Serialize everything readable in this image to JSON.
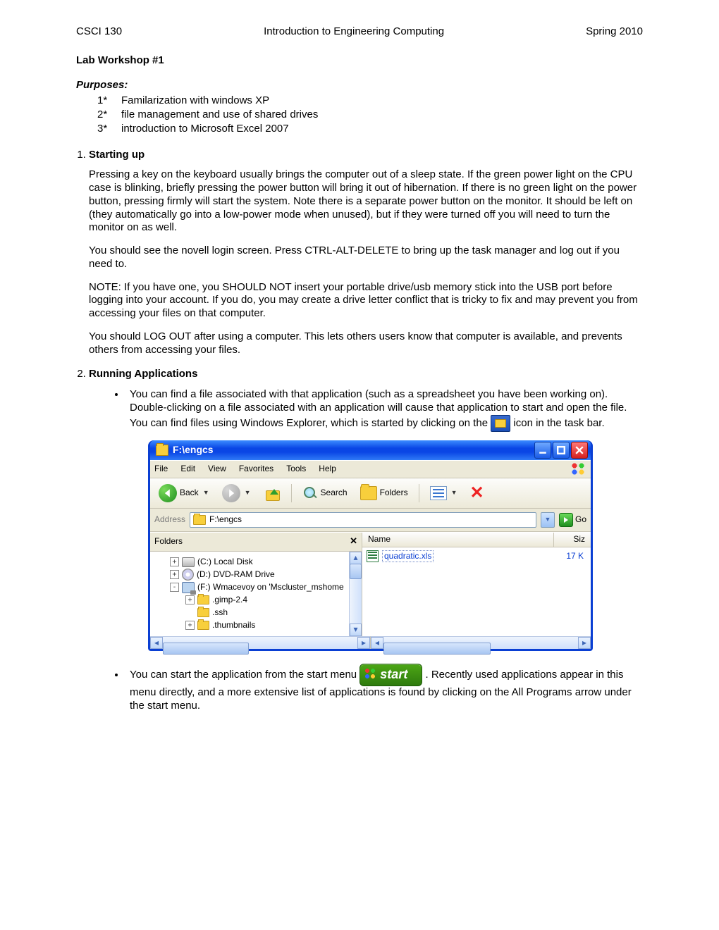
{
  "header": {
    "left": "CSCI 130",
    "center": "Introduction to Engineering Computing",
    "right": "Spring 2010"
  },
  "title": "Lab Workshop #1",
  "purposes_label": "Purposes:",
  "purposes": [
    {
      "n": "1*",
      "t": "Familarization with windows XP"
    },
    {
      "n": "2*",
      "t": "file management and use of shared drives"
    },
    {
      "n": "3*",
      "t": "introduction to Microsoft Excel 2007"
    }
  ],
  "s1": {
    "title": "Starting up",
    "p1": "Pressing a key on the keyboard usually brings the computer out of a sleep state.  If the green power light on the CPU case is blinking, briefly pressing the power button will bring it out of hibernation.  If there is no green light on the power button, pressing firmly will start the system.  Note there is a separate power button on the monitor.  It should be left on (they automatically go into a low-power mode when unused), but if they were turned off you will need to turn the monitor on as well.",
    "p2": "You should see the novell login screen.  Press CTRL-ALT-DELETE to bring up the task manager and log out if you need to.",
    "p3": "NOTE: If you have one, you SHOULD NOT insert your portable drive/usb memory stick into the USB port before logging into your account.  If you do, you may create a drive letter conflict that is tricky to fix and may prevent you from accessing your files on that computer.",
    "p4": "You should LOG OUT after using a computer.  This lets others users know that computer is available, and prevents others from accessing your files."
  },
  "s2": {
    "title": "Running Applications",
    "b1a": "You can find a file associated with that application (such as a spreadsheet you have been working on).  Double-clicking on a file associated with an application will cause that application to start and open the file.  You can find files using Windows Explorer, which is started by clicking on the ",
    "b1b": " icon in the task bar.",
    "b2a": "You can start the application from the start menu ",
    "b2b": ".  Recently used applications appear in this menu directly, and a more extensive list of applications is found by clicking on the All Programs arrow under the start menu.",
    "start_label": "start"
  },
  "explorer": {
    "title": "F:\\engcs",
    "menu": [
      "File",
      "Edit",
      "View",
      "Favorites",
      "Tools",
      "Help"
    ],
    "back": "Back",
    "search": "Search",
    "folders_btn": "Folders",
    "address_label": "Address",
    "address_value": "F:\\engcs",
    "go": "Go",
    "folders_header": "Folders",
    "cols": {
      "name": "Name",
      "size": "Siz"
    },
    "tree": {
      "c": "(C:) Local Disk",
      "d": "(D:) DVD-RAM Drive",
      "f": "(F:) Wmacevoy on 'Mscluster_mshome",
      "f1": ".gimp-2.4",
      "f2": ".ssh",
      "f3": ".thumbnails"
    },
    "file": {
      "name": "quadratic.xls",
      "size": "17 K"
    }
  }
}
